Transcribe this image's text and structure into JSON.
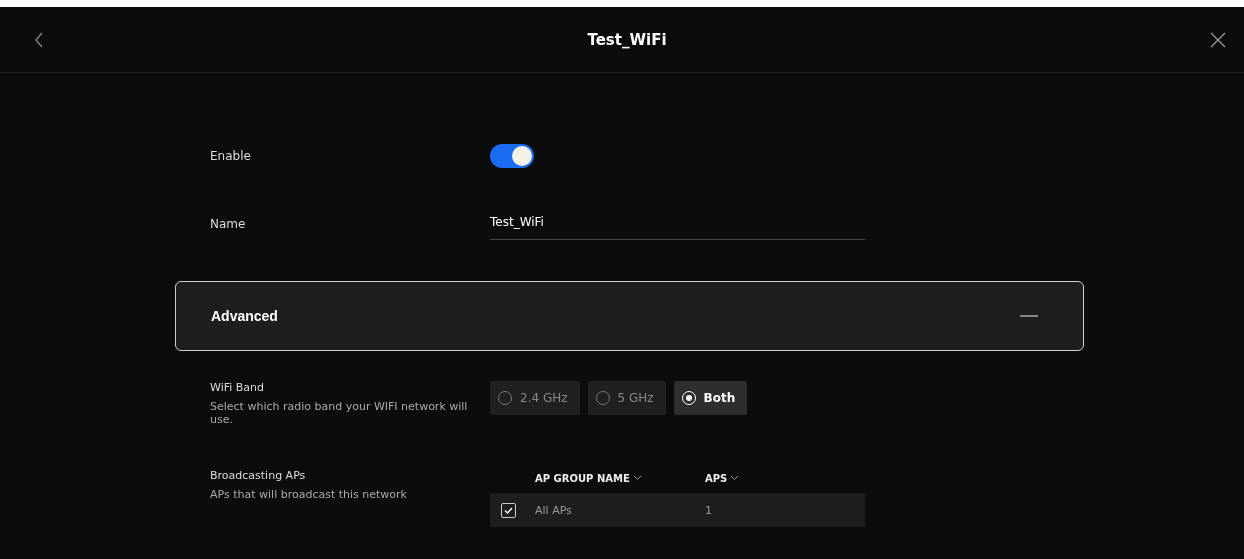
{
  "header": {
    "title": "Test_WiFi"
  },
  "enable": {
    "label": "Enable",
    "on": true
  },
  "name": {
    "label": "Name",
    "value": "Test_WiFi"
  },
  "advanced": {
    "title": "Advanced",
    "expanded": true
  },
  "wifi_band": {
    "label": "WiFi Band",
    "description": "Select which radio band your WIFI network will use.",
    "options": [
      {
        "label": "2.4 GHz",
        "selected": false
      },
      {
        "label": "5 GHz",
        "selected": false
      },
      {
        "label": "Both",
        "selected": true
      }
    ]
  },
  "broadcasting": {
    "label": "Broadcasting APs",
    "description": "APs that will broadcast this network",
    "columns": [
      "AP GROUP NAME",
      "APS"
    ],
    "rows": [
      {
        "checked": true,
        "cells": [
          "All APs",
          "1"
        ]
      }
    ]
  }
}
